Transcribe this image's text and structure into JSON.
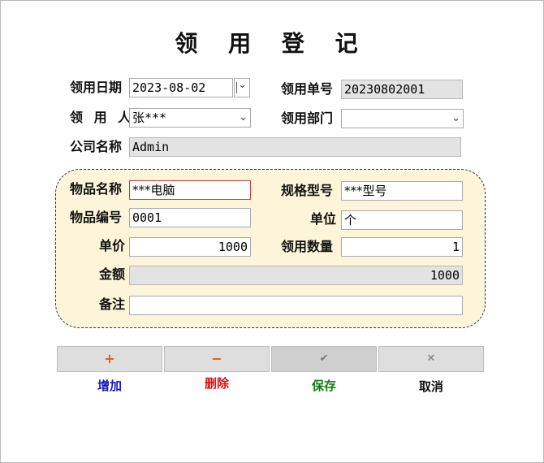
{
  "title": "领 用 登 记",
  "form": {
    "date_label": "领用日期",
    "date_value": "2023-08-02",
    "order_no_label": "领用单号",
    "order_no_value": "20230802001",
    "person_label": "领 用 人",
    "person_value": "张***",
    "dept_label": "领用部门",
    "dept_value": "",
    "company_label": "公司名称",
    "company_value": "Admin"
  },
  "item": {
    "name_label": "物品名称",
    "name_value": "***电脑",
    "spec_label": "规格型号",
    "spec_value": "***型号",
    "code_label": "物品编号",
    "code_value": "0001",
    "unit_label": "单位",
    "unit_value": "个",
    "price_label": "单价",
    "price_value": "1000",
    "qty_label": "领用数量",
    "qty_value": "1",
    "amount_label": "金额",
    "amount_value": "1000",
    "note_label": "备注",
    "note_value": ""
  },
  "buttons": [
    {
      "icon": "+",
      "label": "增加",
      "color": "#1515c8",
      "icon_color": "#e05a10"
    },
    {
      "icon": "−",
      "label": "删除",
      "color": "#e01010",
      "icon_color": "#e05a10"
    },
    {
      "icon": "✔",
      "label": "保存",
      "color": "#157a15",
      "icon_color": "#777777"
    },
    {
      "icon": "✕",
      "label": "取消",
      "color": "#111111",
      "icon_color": "#777777"
    }
  ],
  "icons": {
    "dropdown": "chevron-down-icon",
    "date_spin": "spin-icon"
  }
}
